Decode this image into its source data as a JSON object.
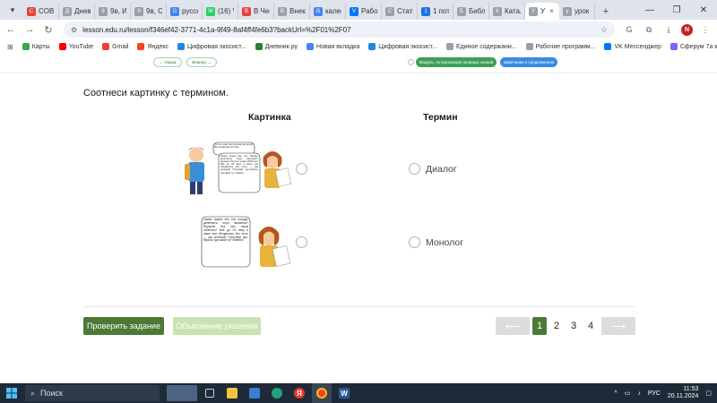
{
  "browser": {
    "tabs": [
      {
        "label": "COBP",
        "color": "#e8453c",
        "glyph": "С"
      },
      {
        "label": "Днев",
        "color": "#9aa0a6",
        "glyph": "Д"
      },
      {
        "label": "9в, И",
        "color": "#9aa0a6",
        "glyph": "9"
      },
      {
        "label": "9в, Сб",
        "color": "#9aa0a6",
        "glyph": "9"
      },
      {
        "label": "русск",
        "color": "#4285f4",
        "glyph": "G"
      },
      {
        "label": "(16) V",
        "color": "#25d366",
        "glyph": "W"
      },
      {
        "label": "В Чес",
        "color": "#e8453c",
        "glyph": "В"
      },
      {
        "label": "Внекл",
        "color": "#9aa0a6",
        "glyph": "В"
      },
      {
        "label": "кален",
        "color": "#4285f4",
        "glyph": "G"
      },
      {
        "label": "Рабо",
        "color": "#0077ff",
        "glyph": "V"
      },
      {
        "label": "Стать",
        "color": "#9aa0a6",
        "glyph": "С"
      },
      {
        "label": "1 пот",
        "color": "#1a73e8",
        "glyph": "1"
      },
      {
        "label": "Библ",
        "color": "#9aa0a6",
        "glyph": "Б"
      },
      {
        "label": "Катал",
        "color": "#9aa0a6",
        "glyph": "К"
      },
      {
        "label": "У",
        "color": "#9aa0a6",
        "glyph": "У"
      },
      {
        "label": "урок",
        "color": "#9aa0a6",
        "glyph": "у"
      }
    ],
    "active_tab_index": 14,
    "url": "lesson.edu.ru/lesson/f346ef42-3771-4c1a-9f49-8af4ff4fe6b3?backUrl=%2F01%2F07",
    "profile_initial": "N",
    "bookmarks": [
      {
        "label": "Карты",
        "color": "#34a853"
      },
      {
        "label": "YouTube",
        "color": "#ff0000"
      },
      {
        "label": "Gmail",
        "color": "#ea4335"
      },
      {
        "label": "Яндекс",
        "color": "#fc3f1d"
      },
      {
        "label": "Цифровая экосист...",
        "color": "#1e88e5"
      },
      {
        "label": "Дневник.ру",
        "color": "#2e7d32"
      },
      {
        "label": "Новая вкладка",
        "color": "#4285f4"
      },
      {
        "label": "Цифровая экосист...",
        "color": "#1e88e5"
      },
      {
        "label": "Единое содержани...",
        "color": "#9aa0a6"
      },
      {
        "label": "Рабочие программ...",
        "color": "#9aa0a6"
      },
      {
        "label": "VK Мессенджер",
        "color": "#0077ff"
      },
      {
        "label": "Сферум 7а кл.",
        "color": "#7b61ff"
      }
    ]
  },
  "lesson": {
    "nav_back": "← Назад",
    "nav_forward": "Вперёд →",
    "module_label": "Модуль. Актуализация опорных знаний",
    "replace_label": "Замечание к продолжению",
    "task_title": "Соотнеси картинку с термином.",
    "col_picture": "Картинка",
    "col_term": "Термин",
    "bubble_small": "Что это еще был за ролик на уроке? Мы поговорим об этом.",
    "bubble_text": "Зачем нужны все эти обходы, дилетанты, перо, записные? Неужели без них никак обойтись? Всё до ХV веку в наши ели обходились без этого — как зелёный! Попробуй рас-берись, где какой тут ставить!",
    "terms": [
      "Диалог",
      "Монолог"
    ],
    "btn_check": "Проверить задание",
    "btn_explain": "Объяснение решения",
    "pages": [
      "1",
      "2",
      "3",
      "4"
    ],
    "current_page": "1",
    "prev_arrow": "⟵",
    "next_arrow": "⟶"
  },
  "taskbar": {
    "search_label": "Поиск",
    "lang": "РУС",
    "time": "11:53",
    "date": "20.11.2024"
  }
}
